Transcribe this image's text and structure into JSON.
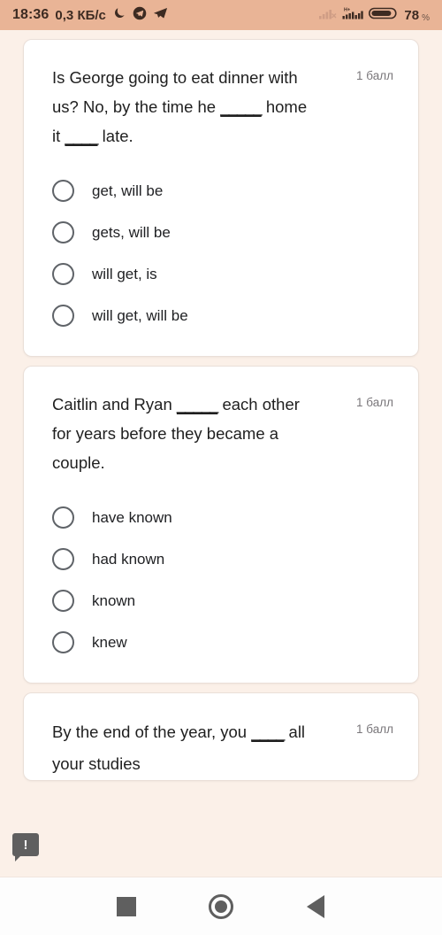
{
  "statusbar": {
    "time": "18:36",
    "data_rate": "0,3 КБ/c",
    "battery_percent": "78",
    "percent_symbol": "%",
    "icons": {
      "dnd": "moon-icon",
      "telegram": "telegram-circle-icon",
      "send": "paper-plane-icon",
      "signal_disabled": "signal-no-service-icon",
      "signal": "signal-bars-icon",
      "network_type": "H+",
      "battery": "battery-icon"
    },
    "colors": {
      "background": "#e9b496",
      "text": "#3d2b22"
    }
  },
  "quiz": {
    "questions": [
      {
        "text_parts": [
          {
            "type": "text",
            "value": "Is George going to eat dinner with us? No, by the time he "
          },
          {
            "type": "blank",
            "value": "_____"
          },
          {
            "type": "text",
            "value": " home it "
          },
          {
            "type": "blank",
            "value": "____"
          },
          {
            "type": "text",
            "value": " late."
          }
        ],
        "text": "Is George going to eat dinner with us? No, by the time he _____ home it ____ late.",
        "points": "1 балл",
        "options": [
          {
            "label": "get, will be",
            "selected": false
          },
          {
            "label": "gets, will be",
            "selected": false
          },
          {
            "label": "will get, is",
            "selected": false
          },
          {
            "label": "will get, will be",
            "selected": false
          }
        ]
      },
      {
        "text_parts": [
          {
            "type": "text",
            "value": "Caitlin and Ryan "
          },
          {
            "type": "blank",
            "value": "_____"
          },
          {
            "type": "text",
            "value": " each other for years before they became a couple."
          }
        ],
        "text": "Caitlin and Ryan _____ each other for years before they became a couple.",
        "points": "1 балл",
        "options": [
          {
            "label": "have known",
            "selected": false
          },
          {
            "label": "had known",
            "selected": false
          },
          {
            "label": "known",
            "selected": false
          },
          {
            "label": "knew",
            "selected": false
          }
        ]
      },
      {
        "text_parts": [
          {
            "type": "text",
            "value": "By the end of the year, you "
          },
          {
            "type": "blank",
            "value": "____"
          },
          {
            "type": "text",
            "value": " all your studies"
          }
        ],
        "text": "By the end of the year, you ____ all your studies",
        "points": "1 балл",
        "options": []
      }
    ]
  },
  "tooltip_badge": {
    "glyph": "!",
    "name": "warning-tooltip-icon"
  },
  "navbar": {
    "recents": "recents-square-icon",
    "home": "home-circle-icon",
    "back": "back-triangle-icon"
  },
  "colors": {
    "page_background": "#fbf0e8",
    "card_background": "#ffffff",
    "card_border": "#eadfd8",
    "text_primary": "#1f1f1f",
    "text_secondary": "#79767a",
    "radio_stroke": "#5f6368",
    "nav_icon": "#5f5f5f"
  }
}
